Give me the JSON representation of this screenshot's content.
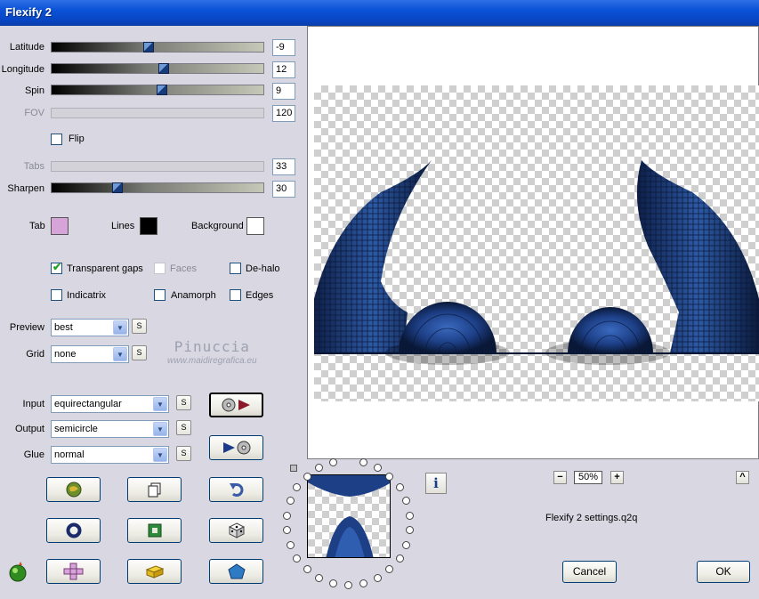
{
  "window": {
    "title": "Flexify 2"
  },
  "params": {
    "latitude": {
      "label": "Latitude",
      "value": "-9",
      "position": 0.46
    },
    "longitude": {
      "label": "Longitude",
      "value": "12",
      "position": 0.53
    },
    "spin": {
      "label": "Spin",
      "value": "9",
      "position": 0.52
    },
    "fov": {
      "label": "FOV",
      "value": "120"
    },
    "tabs": {
      "label": "Tabs",
      "value": "33"
    },
    "sharpen": {
      "label": "Sharpen",
      "value": "30",
      "position": 0.31
    }
  },
  "flip": {
    "label": "Flip",
    "checked": false
  },
  "colors": {
    "tab": {
      "label": "Tab",
      "color": "#d6a4d8"
    },
    "lines": {
      "label": "Lines",
      "color": "#000000"
    },
    "background": {
      "label": "Background",
      "color": "#ffffff"
    }
  },
  "options": {
    "transparent_gaps": {
      "label": "Transparent gaps",
      "checked": true
    },
    "faces": {
      "label": "Faces",
      "checked": false
    },
    "dehalo": {
      "label": "De-halo",
      "checked": false
    },
    "indicatrix": {
      "label": "Indicatrix",
      "checked": false
    },
    "anamorph": {
      "label": "Anamorph",
      "checked": false
    },
    "edges": {
      "label": "Edges",
      "checked": false
    }
  },
  "preview_select": {
    "label": "Preview",
    "value": "best"
  },
  "grid_select": {
    "label": "Grid",
    "value": "none"
  },
  "input_select": {
    "label": "Input",
    "value": "equirectangular"
  },
  "output_select": {
    "label": "Output",
    "value": "semicircle"
  },
  "glue_select": {
    "label": "Glue",
    "value": "normal"
  },
  "small_button_label": "S",
  "watermark": {
    "line1": "Pinuccia",
    "line2": "www.maidiregrafica.eu"
  },
  "zoom": {
    "value": "50%",
    "minus": "−",
    "plus": "+",
    "caret": "^"
  },
  "settings_file": "Flexify 2 settings.q2q",
  "buttons": {
    "cancel": "Cancel",
    "ok": "OK"
  },
  "info_icon": "i"
}
